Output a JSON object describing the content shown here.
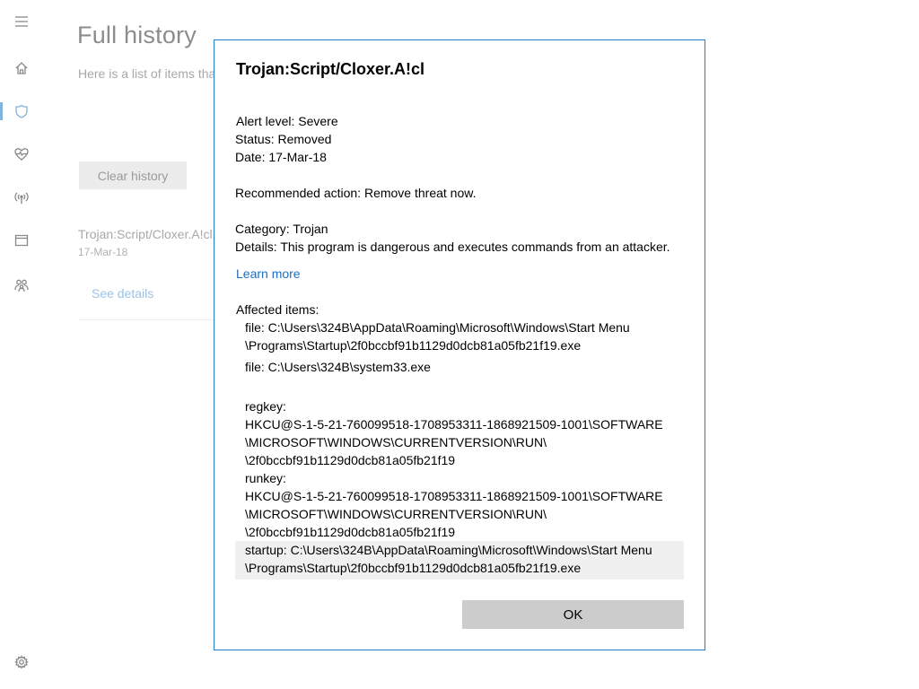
{
  "rail": {
    "items": [
      {
        "name": "menu"
      },
      {
        "name": "home"
      },
      {
        "name": "virus-protection"
      },
      {
        "name": "device-health"
      },
      {
        "name": "firewall"
      },
      {
        "name": "app-browser-control"
      },
      {
        "name": "family-options"
      },
      {
        "name": "settings"
      }
    ],
    "active": "virus-protection",
    "accent_color": "#7fb2dd"
  },
  "page": {
    "title": "Full history",
    "description": "Here is a list of items that Windows Defender Antivirus detected as threats on your device.",
    "clear_button": "Clear history",
    "history_item": {
      "name": "Trojan:Script/Cloxer.A!cl",
      "date": "17-Mar-18",
      "see_details": "See details"
    }
  },
  "dialog": {
    "title": "Trojan:Script/Cloxer.A!cl",
    "alert_level": "Alert level: Severe",
    "status": "Status: Removed",
    "date": "Date: 17-Mar-18",
    "recommended_action": "Recommended action: Remove threat now.",
    "category": "Category:  Trojan",
    "details": "Details:  This program is dangerous and executes commands from an attacker.",
    "learn_more": "Learn more",
    "affected_label": "Affected items:",
    "affected_items": {
      "file1_line1": "file: C:\\Users\\324B\\AppData\\Roaming\\Microsoft\\Windows\\Start Menu",
      "file1_line2": "\\Programs\\Startup\\2f0bccbf91b1129d0dcb81a05fb21f19.exe",
      "file2": "file: C:\\Users\\324B\\system33.exe",
      "regkey_label": "regkey:",
      "regkey_line1": "HKCU@S-1-5-21-760099518-1708953311-1868921509-1001\\SOFTWARE",
      "regkey_line2": "\\MICROSOFT\\WINDOWS\\CURRENTVERSION\\RUN\\",
      "regkey_line3": "\\2f0bccbf91b1129d0dcb81a05fb21f19",
      "runkey_label": "runkey:",
      "runkey_line1": "HKCU@S-1-5-21-760099518-1708953311-1868921509-1001\\SOFTWARE",
      "runkey_line2": "\\MICROSOFT\\WINDOWS\\CURRENTVERSION\\RUN\\",
      "runkey_line3": "\\2f0bccbf91b1129d0dcb81a05fb21f19",
      "startup_line1": "startup: C:\\Users\\324B\\AppData\\Roaming\\Microsoft\\Windows\\Start Menu",
      "startup_line2": "\\Programs\\Startup\\2f0bccbf91b1129d0dcb81a05fb21f19.exe"
    },
    "ok_button": "OK",
    "link_color": "#1c6fc1",
    "border_color": "#1f7ac9"
  }
}
